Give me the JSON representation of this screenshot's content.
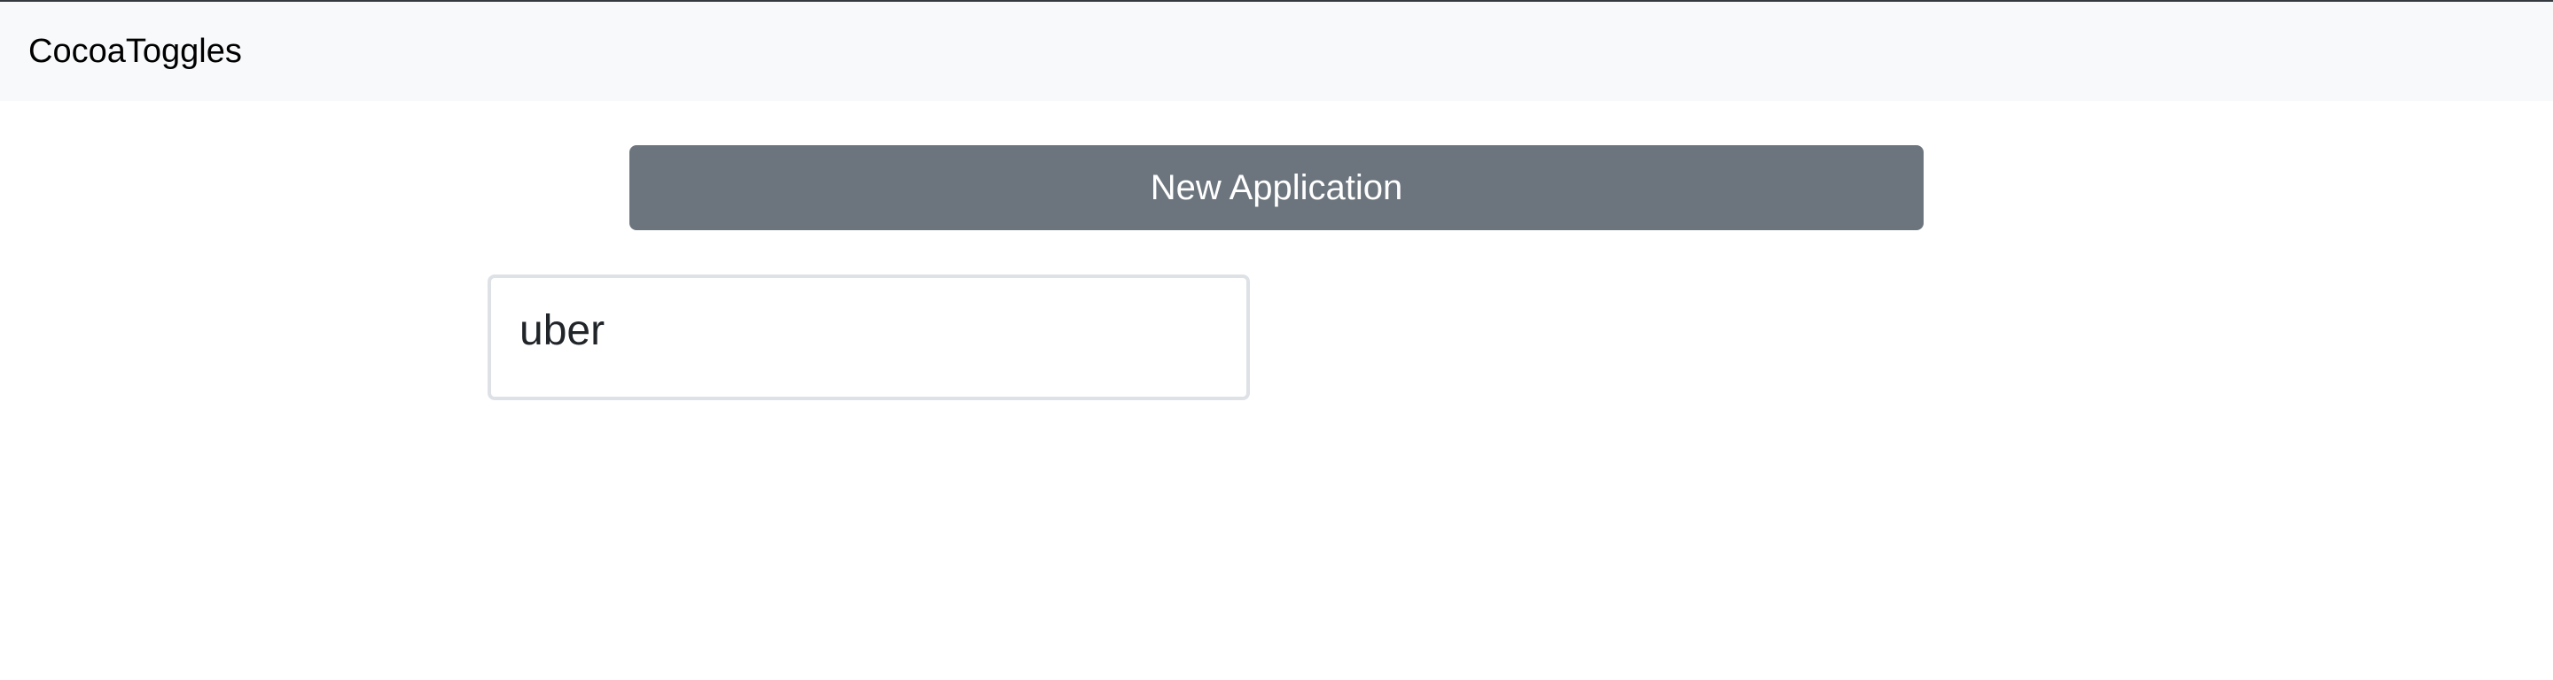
{
  "navbar": {
    "brand": "CocoaToggles"
  },
  "main": {
    "new_application_label": "New Application",
    "applications": [
      {
        "name": "uber"
      }
    ]
  },
  "colors": {
    "navbar_bg": "#f8f9fa",
    "button_bg": "#6c757d",
    "card_border": "#dee2e6"
  }
}
